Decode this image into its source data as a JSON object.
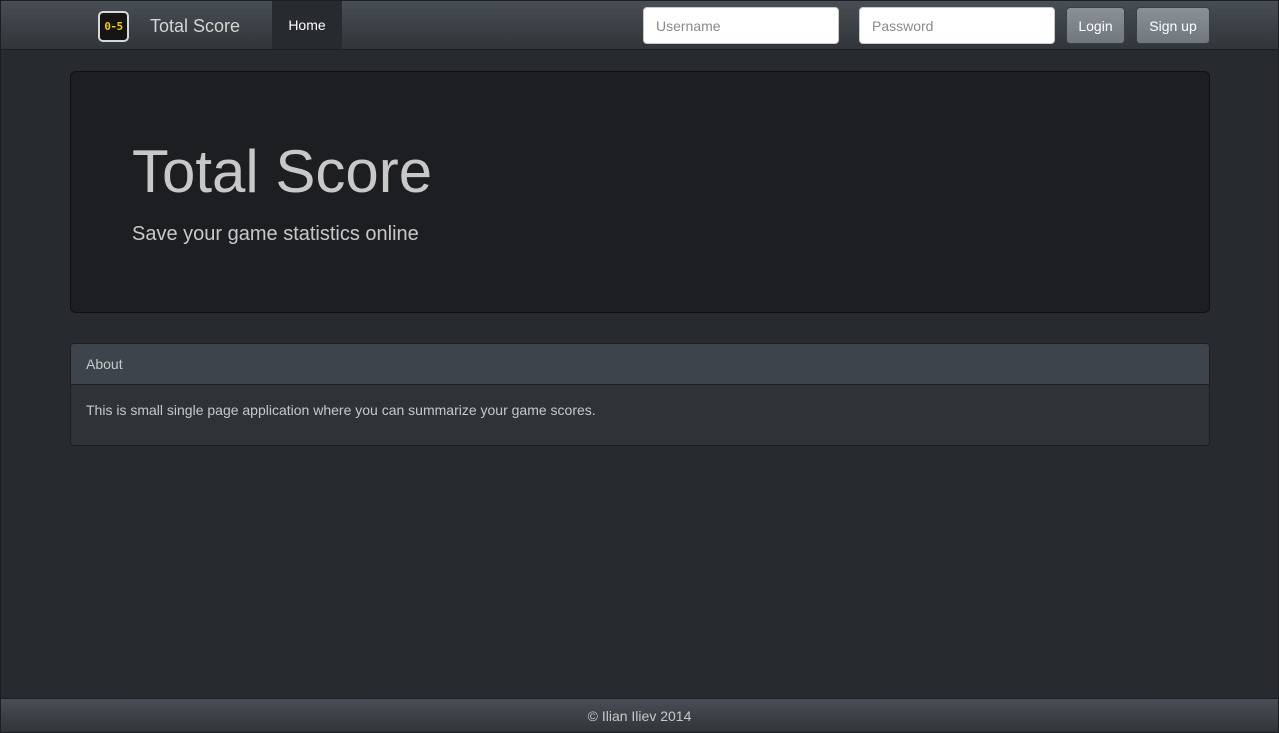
{
  "navbar": {
    "logo_text": "0-5",
    "brand": "Total Score",
    "home_label": "Home",
    "username_placeholder": "Username",
    "password_placeholder": "Password",
    "login_label": "Login",
    "signup_label": "Sign up"
  },
  "jumbotron": {
    "title": "Total Score",
    "subtitle": "Save your game statistics online"
  },
  "about_panel": {
    "heading": "About",
    "body": "This is small single page application where you can summarize your game scores."
  },
  "footer": {
    "text": "© Ilian Iliev 2014"
  },
  "colors": {
    "background": "#272b30",
    "navbar": "#3a3f44",
    "jumbotron": "#1c1e22",
    "panel_heading": "#3e444c",
    "button": "#7a8288",
    "logo_digits": "#f2c800"
  }
}
